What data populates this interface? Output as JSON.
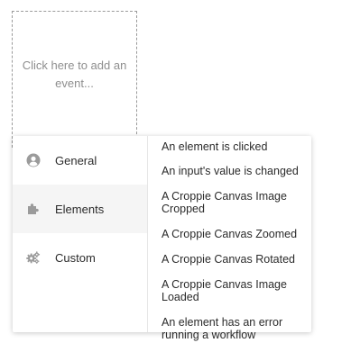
{
  "placeholder": {
    "text": "Click here to add an event..."
  },
  "categories": [
    {
      "label": "General",
      "icon": "user-circle-icon",
      "active": false
    },
    {
      "label": "Elements",
      "icon": "puzzle-piece-icon",
      "active": true
    },
    {
      "label": "Custom",
      "icon": "gears-icon",
      "active": false
    }
  ],
  "events": [
    "An element is clicked",
    "An input's value is changed",
    "A Croppie Canvas Image Cropped",
    "A Croppie Canvas Zoomed",
    "A Croppie Canvas Rotated",
    "A Croppie Canvas Image Loaded",
    "An element has an error running a workflow"
  ]
}
